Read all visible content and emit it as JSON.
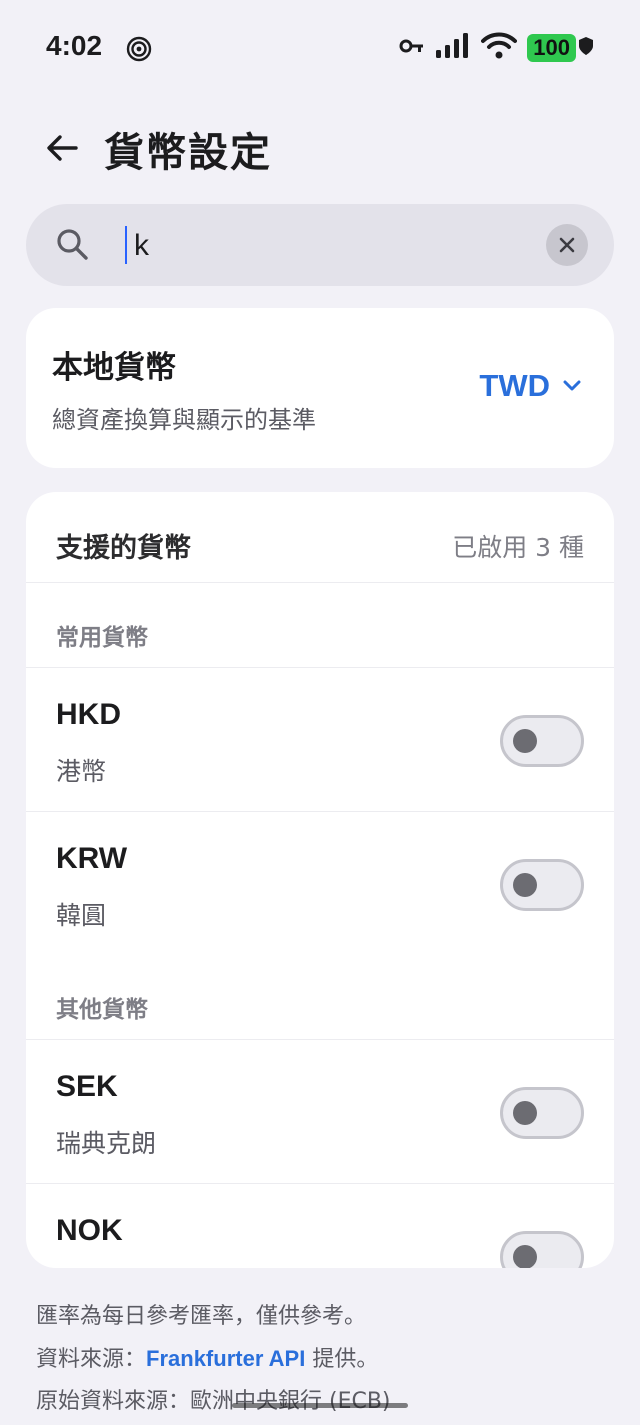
{
  "status_bar": {
    "time": "4:02",
    "battery": "100"
  },
  "header": {
    "title": "貨幣設定"
  },
  "search": {
    "value": "k",
    "placeholder": ""
  },
  "local_currency": {
    "title": "本地貨幣",
    "description": "總資產換算與顯示的基準",
    "selected": "TWD"
  },
  "supported": {
    "title": "支援的貨幣",
    "enabled_count": "已啟用 3 種",
    "sections": [
      {
        "label": "常用貨幣",
        "items": [
          {
            "code": "HKD",
            "name": "港幣",
            "enabled": false
          },
          {
            "code": "KRW",
            "name": "韓圓",
            "enabled": false
          }
        ]
      },
      {
        "label": "其他貨幣",
        "items": [
          {
            "code": "SEK",
            "name": "瑞典克朗",
            "enabled": false
          },
          {
            "code": "NOK",
            "name": "",
            "enabled": false
          }
        ]
      }
    ]
  },
  "footer": {
    "line1": "匯率為每日參考匯率，僅供參考。",
    "line2_prefix": "資料來源：",
    "line2_link": "Frankfurter API",
    "line2_suffix": " 提供。",
    "line3": "原始資料來源：歐洲中央銀行 (ECB)"
  },
  "colors": {
    "accent": "#2a6fdb",
    "battery": "#2fc84f",
    "background": "#f2f1f7"
  }
}
